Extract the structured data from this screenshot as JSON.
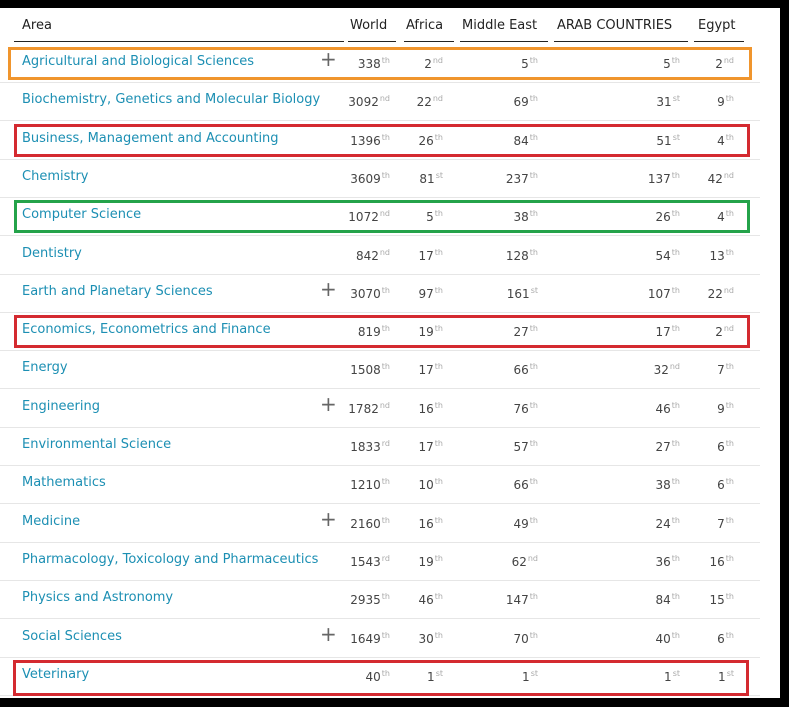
{
  "headers": {
    "area": "Area",
    "world": "World",
    "africa": "Africa",
    "middle_east": "Middle East",
    "arab": "ARAB COUNTRIES",
    "egypt": "Egypt"
  },
  "colors": {
    "orange": "#f0952d",
    "red": "#d42a30",
    "green": "#24a34a",
    "link": "#1c8fb3"
  },
  "rows": [
    {
      "area": "Agricultural and Biological Sciences",
      "plus": "+",
      "world": "338",
      "world_s": "th",
      "africa": "2",
      "africa_s": "nd",
      "me": "5",
      "me_s": "th",
      "arab": "5",
      "arab_s": "th",
      "egypt": "2",
      "egypt_s": "nd"
    },
    {
      "area": "Biochemistry, Genetics and Molecular Biology",
      "plus": "",
      "world": "3092",
      "world_s": "nd",
      "africa": "22",
      "africa_s": "nd",
      "me": "69",
      "me_s": "th",
      "arab": "31",
      "arab_s": "st",
      "egypt": "9",
      "egypt_s": "th"
    },
    {
      "area": "Business, Management and Accounting",
      "plus": "",
      "world": "1396",
      "world_s": "th",
      "africa": "26",
      "africa_s": "th",
      "me": "84",
      "me_s": "th",
      "arab": "51",
      "arab_s": "st",
      "egypt": "4",
      "egypt_s": "th"
    },
    {
      "area": "Chemistry",
      "plus": "",
      "world": "3609",
      "world_s": "th",
      "africa": "81",
      "africa_s": "st",
      "me": "237",
      "me_s": "th",
      "arab": "137",
      "arab_s": "th",
      "egypt": "42",
      "egypt_s": "nd"
    },
    {
      "area": "Computer Science",
      "plus": "",
      "world": "1072",
      "world_s": "nd",
      "africa": "5",
      "africa_s": "th",
      "me": "38",
      "me_s": "th",
      "arab": "26",
      "arab_s": "th",
      "egypt": "4",
      "egypt_s": "th"
    },
    {
      "area": "Dentistry",
      "plus": "",
      "world": "842",
      "world_s": "nd",
      "africa": "17",
      "africa_s": "th",
      "me": "128",
      "me_s": "th",
      "arab": "54",
      "arab_s": "th",
      "egypt": "13",
      "egypt_s": "th"
    },
    {
      "area": "Earth and Planetary Sciences",
      "plus": "+",
      "world": "3070",
      "world_s": "th",
      "africa": "97",
      "africa_s": "th",
      "me": "161",
      "me_s": "st",
      "arab": "107",
      "arab_s": "th",
      "egypt": "22",
      "egypt_s": "nd"
    },
    {
      "area": "Economics, Econometrics and Finance",
      "plus": "",
      "world": "819",
      "world_s": "th",
      "africa": "19",
      "africa_s": "th",
      "me": "27",
      "me_s": "th",
      "arab": "17",
      "arab_s": "th",
      "egypt": "2",
      "egypt_s": "nd"
    },
    {
      "area": "Energy",
      "plus": "",
      "world": "1508",
      "world_s": "th",
      "africa": "17",
      "africa_s": "th",
      "me": "66",
      "me_s": "th",
      "arab": "32",
      "arab_s": "nd",
      "egypt": "7",
      "egypt_s": "th"
    },
    {
      "area": "Engineering",
      "plus": "+",
      "world": "1782",
      "world_s": "nd",
      "africa": "16",
      "africa_s": "th",
      "me": "76",
      "me_s": "th",
      "arab": "46",
      "arab_s": "th",
      "egypt": "9",
      "egypt_s": "th"
    },
    {
      "area": "Environmental Science",
      "plus": "",
      "world": "1833",
      "world_s": "rd",
      "africa": "17",
      "africa_s": "th",
      "me": "57",
      "me_s": "th",
      "arab": "27",
      "arab_s": "th",
      "egypt": "6",
      "egypt_s": "th"
    },
    {
      "area": "Mathematics",
      "plus": "",
      "world": "1210",
      "world_s": "th",
      "africa": "10",
      "africa_s": "th",
      "me": "66",
      "me_s": "th",
      "arab": "38",
      "arab_s": "th",
      "egypt": "6",
      "egypt_s": "th"
    },
    {
      "area": "Medicine",
      "plus": "+",
      "world": "2160",
      "world_s": "th",
      "africa": "16",
      "africa_s": "th",
      "me": "49",
      "me_s": "th",
      "arab": "24",
      "arab_s": "th",
      "egypt": "7",
      "egypt_s": "th"
    },
    {
      "area": "Pharmacology, Toxicology and Pharmaceutics",
      "plus": "",
      "world": "1543",
      "world_s": "rd",
      "africa": "19",
      "africa_s": "th",
      "me": "62",
      "me_s": "nd",
      "arab": "36",
      "arab_s": "th",
      "egypt": "16",
      "egypt_s": "th"
    },
    {
      "area": "Physics and Astronomy",
      "plus": "",
      "world": "2935",
      "world_s": "th",
      "africa": "46",
      "africa_s": "th",
      "me": "147",
      "me_s": "th",
      "arab": "84",
      "arab_s": "th",
      "egypt": "15",
      "egypt_s": "th"
    },
    {
      "area": "Social Sciences",
      "plus": "+",
      "world": "1649",
      "world_s": "th",
      "africa": "30",
      "africa_s": "th",
      "me": "70",
      "me_s": "th",
      "arab": "40",
      "arab_s": "th",
      "egypt": "6",
      "egypt_s": "th"
    },
    {
      "area": "Veterinary",
      "plus": "",
      "world": "40",
      "world_s": "th",
      "africa": "1",
      "africa_s": "st",
      "me": "1",
      "me_s": "st",
      "arab": "1",
      "arab_s": "st",
      "egypt": "1",
      "egypt_s": "st"
    }
  ],
  "highlights": [
    {
      "row": 0,
      "color": "orange"
    },
    {
      "row": 2,
      "color": "red"
    },
    {
      "row": 4,
      "color": "green"
    },
    {
      "row": 7,
      "color": "red"
    },
    {
      "row": 16,
      "color": "red"
    }
  ]
}
